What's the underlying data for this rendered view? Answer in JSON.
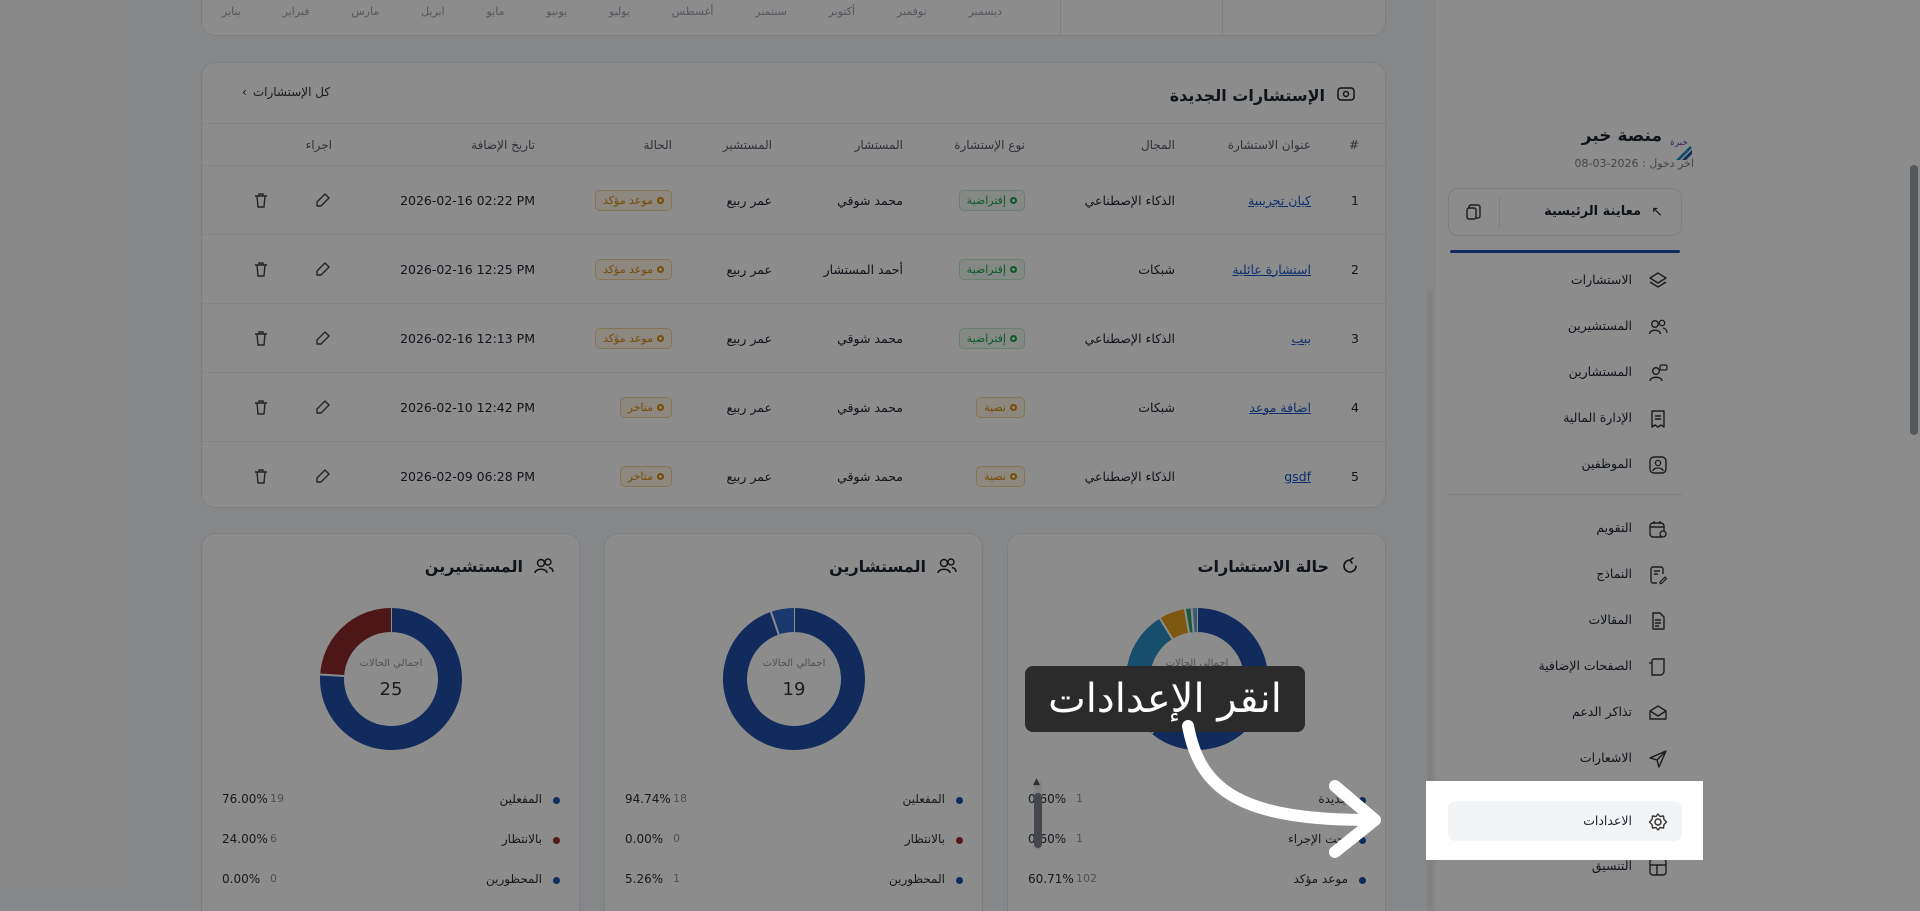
{
  "months": [
    "ديسمبر",
    "نوفمبر",
    "أكتوبر",
    "سبتمبر",
    "أغسطس",
    "يوليو",
    "يونيو",
    "مايو",
    "ابريل",
    "مارس",
    "فبراير",
    "يناير"
  ],
  "consultations": {
    "title": "الإستشارات الجديدة",
    "all_link": "كل الإستشارات",
    "headers": [
      "#",
      "عنوان الاستشارة",
      "المجال",
      "نوع الإستشارة",
      "المستشار",
      "المستشير",
      "الحالة",
      "تاريخ الإضافة",
      "اجراء"
    ],
    "rows": [
      {
        "num": "1",
        "title": "كيان تجريبية",
        "field": "الذكاء الإصطناعي",
        "type": "إفتراضية",
        "type_style": "green",
        "consultant": "محمد شوقي",
        "client": "عمر ربيع",
        "status": "موعد مؤكد",
        "date": "2026-02-16 02:22 PM"
      },
      {
        "num": "2",
        "title": "استشارة عائلية",
        "field": "شبكات",
        "type": "إفتراضية",
        "type_style": "green",
        "consultant": "أحمد المستشار",
        "client": "عمر ربيع",
        "status": "موعد مؤكد",
        "date": "2026-02-16 12:25 PM"
      },
      {
        "num": "3",
        "title": "ببب",
        "field": "الذكاء الإصطناعي",
        "type": "إفتراضية",
        "type_style": "green",
        "consultant": "محمد شوقي",
        "client": "عمر ربيع",
        "status": "موعد مؤكد",
        "date": "2026-02-16 12:13 PM"
      },
      {
        "num": "4",
        "title": "اضافة موعد",
        "field": "شبكات",
        "type": "نصية",
        "type_style": "orange",
        "consultant": "محمد شوقي",
        "client": "عمر ربيع",
        "status": "متاخر",
        "date": "2026-02-10 12:42 PM"
      },
      {
        "num": "5",
        "title": "gsdf",
        "field": "الذكاء الإصطناعي",
        "type": "نصية",
        "type_style": "orange",
        "consultant": "محمد شوقي",
        "client": "عمر ربيع",
        "status": "متاخر",
        "date": "2026-02-09 06:28 PM"
      }
    ]
  },
  "donuts": [
    {
      "title": "حالة الاستشارات",
      "icon": "refresh-icon",
      "center_label": "اجمالي الحالات",
      "legend": [
        {
          "name": "جديدة",
          "count": "1",
          "pct": "0.60%",
          "color": "#1e4fa8"
        },
        {
          "name": "تحت الإجراء",
          "count": "1",
          "pct": "0.60%",
          "color": "#1e4fa8"
        },
        {
          "name": "موعد مؤكد",
          "count": "102",
          "pct": "60.71%",
          "color": "#1e4fa8"
        }
      ],
      "segments": [
        {
          "value": 60.71,
          "color": "#1e4fa8"
        },
        {
          "value": 4,
          "color": "#1e4fa8"
        },
        {
          "value": 26,
          "color": "#2b8fc4"
        },
        {
          "value": 6,
          "color": "#e6a020"
        },
        {
          "value": 1.5,
          "color": "#2aa36b"
        },
        {
          "value": 1.2,
          "color": "#6aa3d8"
        }
      ]
    },
    {
      "title": "المستشارين",
      "icon": "users-icon",
      "center_label": "اجمالي الحالات",
      "center_value": "19",
      "legend": [
        {
          "name": "المفعلين",
          "count": "18",
          "pct": "94.74%",
          "color": "#1e4fa8"
        },
        {
          "name": "بالانتظار",
          "count": "0",
          "pct": "0.00%",
          "color": "#9b2c2c"
        },
        {
          "name": "المحظورين",
          "count": "1",
          "pct": "5.26%",
          "color": "#1e4fa8"
        }
      ],
      "segments": [
        {
          "value": 94.74,
          "color": "#1e4fa8"
        },
        {
          "value": 5.26,
          "color": "#2f66c9"
        }
      ]
    },
    {
      "title": "المستشيرين",
      "icon": "users-icon",
      "center_label": "اجمالي الحالات",
      "center_value": "25",
      "legend": [
        {
          "name": "المفعلين",
          "count": "19",
          "pct": "76.00%",
          "color": "#1e4fa8"
        },
        {
          "name": "بالانتظار",
          "count": "6",
          "pct": "24.00%",
          "color": "#9b2c2c"
        },
        {
          "name": "المحظورين",
          "count": "0",
          "pct": "0.00%",
          "color": "#1e4fa8"
        }
      ],
      "segments": [
        {
          "value": 76,
          "color": "#1e4fa8"
        },
        {
          "value": 24,
          "color": "#8e2a2a"
        }
      ]
    }
  ],
  "sidebar": {
    "brand": "منصة خبر",
    "logo_text": "خبرة",
    "last_login": "اخر دخول : 2026-03-08",
    "preview": "معاينة الرئيسية",
    "items": [
      {
        "label": "الاستشارات",
        "icon": "layers-icon"
      },
      {
        "label": "المستشيرين",
        "icon": "users-icon"
      },
      {
        "label": "المستشارين",
        "icon": "user-chat-icon"
      },
      {
        "label": "الإدارة المالية",
        "icon": "receipt-icon"
      },
      {
        "label": "الموظفين",
        "icon": "user-square-icon"
      },
      {
        "label": "التقويم",
        "icon": "calendar-icon"
      },
      {
        "label": "النماذج",
        "icon": "form-icon"
      },
      {
        "label": "المقالات",
        "icon": "document-icon"
      },
      {
        "label": "الصفحات الإضافية",
        "icon": "pages-icon"
      },
      {
        "label": "تذاكر الدعم",
        "icon": "ticket-icon"
      },
      {
        "label": "الاشعارات",
        "icon": "send-icon"
      },
      {
        "label": "الاعدادات",
        "icon": "gear-icon"
      },
      {
        "label": "التنسيق",
        "icon": "layout-icon"
      }
    ]
  },
  "tooltip": "انقر الإعدادات"
}
